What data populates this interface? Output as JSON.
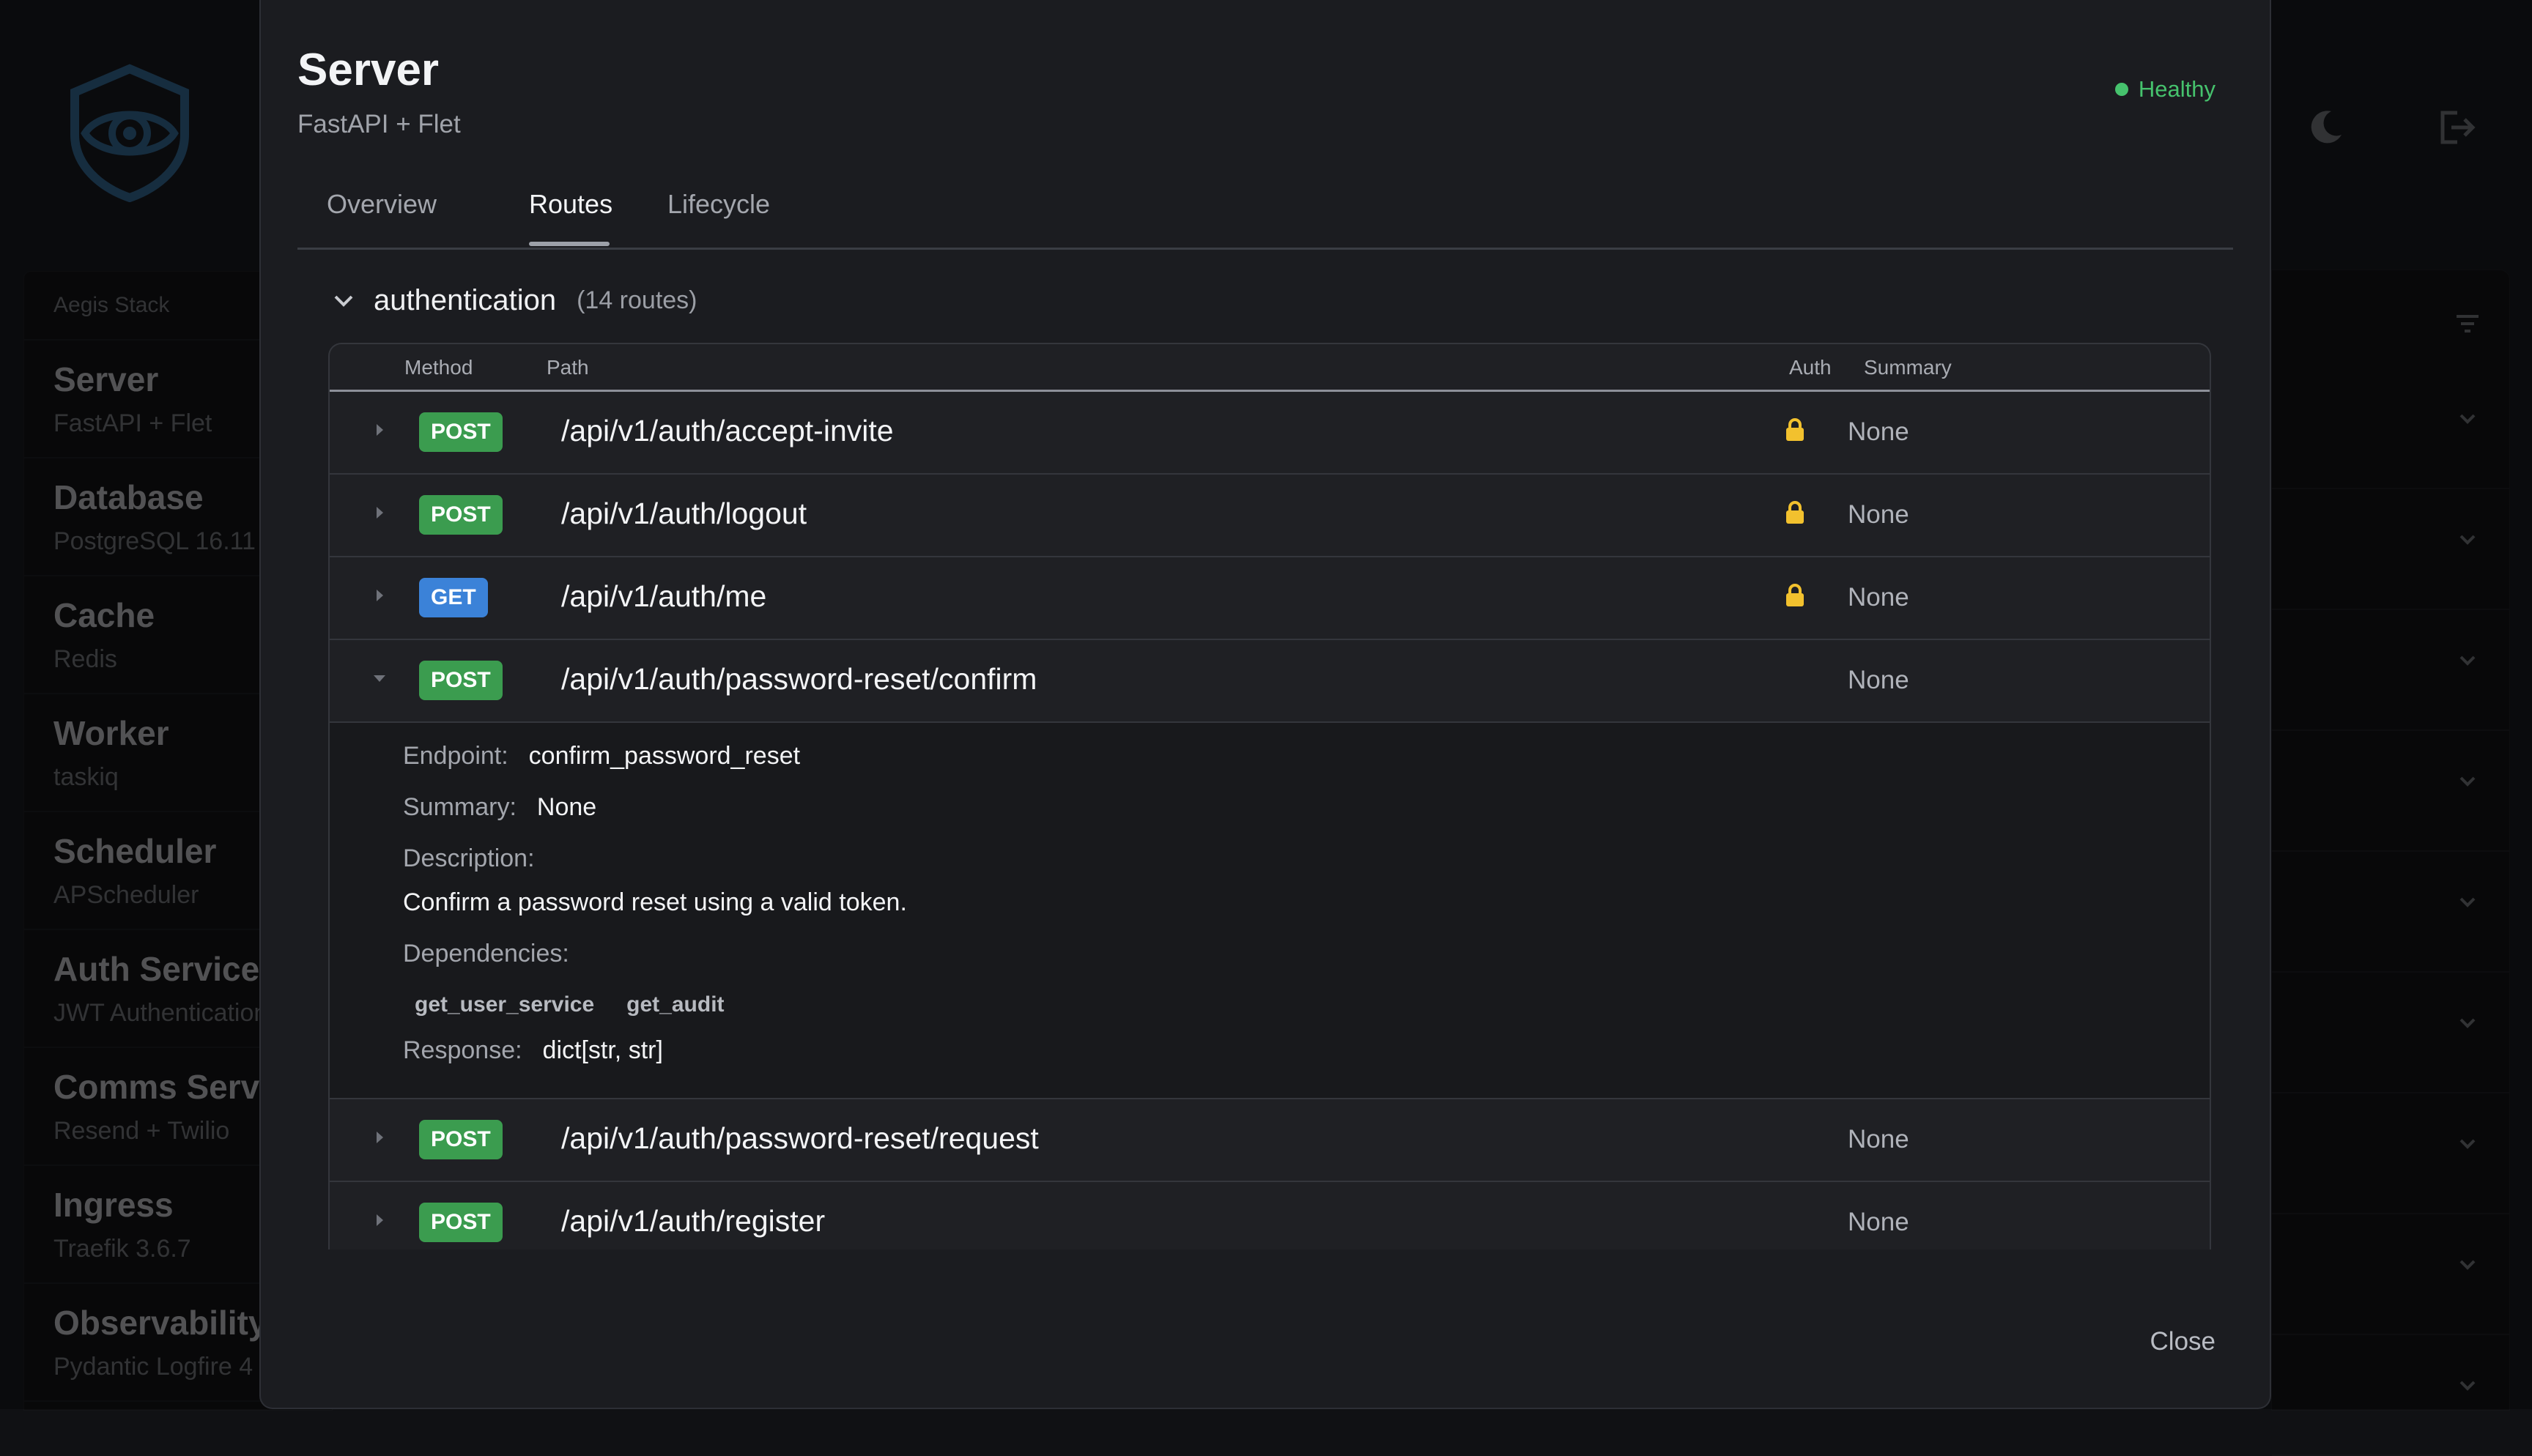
{
  "colors": {
    "healthy": "#46c26d",
    "post": "#3b9c4f",
    "get": "#3b82d8",
    "lock": "#f2c12e"
  },
  "background": {
    "stack_label": "Aegis Stack",
    "services": [
      {
        "title": "Server",
        "subtitle": "FastAPI + Flet"
      },
      {
        "title": "Database",
        "subtitle": "PostgreSQL 16.11"
      },
      {
        "title": "Cache",
        "subtitle": "Redis"
      },
      {
        "title": "Worker",
        "subtitle": "taskiq"
      },
      {
        "title": "Scheduler",
        "subtitle": "APScheduler"
      },
      {
        "title": "Auth Service",
        "subtitle": "JWT Authentication"
      },
      {
        "title": "Comms Service",
        "subtitle": "Resend + Twilio"
      },
      {
        "title": "Ingress",
        "subtitle": "Traefik 3.6.7"
      },
      {
        "title": "Observability",
        "subtitle": "Pydantic Logfire 4"
      }
    ],
    "icons": [
      "shield-eye-logo-icon",
      "moon-icon",
      "logout-icon",
      "filter-icon",
      "chevron-down-icon"
    ]
  },
  "modal": {
    "title": "Server",
    "subtitle": "FastAPI + Flet",
    "status": "Healthy",
    "tabs": [
      "Overview",
      "Routes",
      "Lifecycle"
    ],
    "active_tab": "Routes",
    "close_label": "Close"
  },
  "group": {
    "name": "authentication",
    "count": "(14 routes)"
  },
  "table": {
    "headers": {
      "method": "Method",
      "path": "Path",
      "auth": "Auth",
      "summary": "Summary"
    }
  },
  "routes": [
    {
      "method": "POST",
      "path": "/api/v1/auth/accept-invite",
      "auth": true,
      "summary": "None"
    },
    {
      "method": "POST",
      "path": "/api/v1/auth/logout",
      "auth": true,
      "summary": "None"
    },
    {
      "method": "GET",
      "path": "/api/v1/auth/me",
      "auth": true,
      "summary": "None"
    },
    {
      "method": "POST",
      "path": "/api/v1/auth/password-reset/confirm",
      "auth": false,
      "summary": "None",
      "expanded": true
    },
    {
      "method": "POST",
      "path": "/api/v1/auth/password-reset/request",
      "auth": false,
      "summary": "None"
    },
    {
      "method": "POST",
      "path": "/api/v1/auth/register",
      "auth": false,
      "summary": "None"
    }
  ],
  "detail": {
    "endpoint_label": "Endpoint:",
    "endpoint": "confirm_password_reset",
    "summary_label": "Summary:",
    "summary": "None",
    "description_label": "Description:",
    "description": "Confirm a password reset using a valid token.",
    "dependencies_label": "Dependencies:",
    "dependencies": [
      "get_user_service",
      "get_audit"
    ],
    "response_label": "Response:",
    "response": "dict[str, str]"
  }
}
